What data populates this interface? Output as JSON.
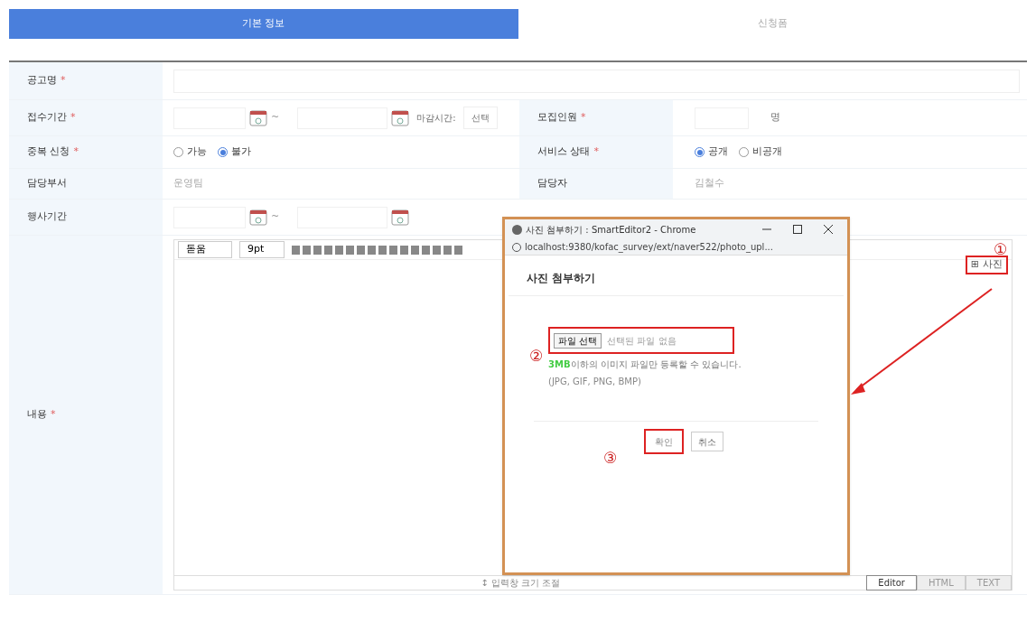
{
  "tabs": [
    {
      "label": "기본 정보",
      "selected": true
    },
    {
      "label": "신청폼",
      "selected": false
    }
  ],
  "title_row": {
    "label": "공고명",
    "required_mark": "*"
  },
  "period_row": {
    "label": "접수기간",
    "required_mark": "*",
    "separator": "~",
    "deadline_label": "마감시간:",
    "deadline_select": "선택"
  },
  "capacity": {
    "label": "모집인원",
    "required_mark": "*",
    "unit": "명"
  },
  "duplicate": {
    "label": "중복 신청",
    "required_mark": "*",
    "options": [
      {
        "label": "가능",
        "selected": false
      },
      {
        "label": "불가",
        "selected": true
      }
    ]
  },
  "service": {
    "label": "서비스 상태",
    "required_mark": "*",
    "options": [
      {
        "label": "공개",
        "selected": true
      },
      {
        "label": "비공개",
        "selected": false
      }
    ]
  },
  "department": {
    "label": "담당부서",
    "value": "운영팀"
  },
  "manager": {
    "label": "담당자",
    "value": "김철수"
  },
  "event_period": {
    "label": "행사기간",
    "separator": "~"
  },
  "content": {
    "label": "내용",
    "required_mark": "*",
    "toolbar": {
      "font": "돋움",
      "size": "9pt"
    },
    "photo_icon": "⊞",
    "photo_button": "사진",
    "resize": "↕ 입력창 크기 조절",
    "modes": [
      {
        "label": "Editor",
        "selected": true
      },
      {
        "label": "HTML",
        "selected": false
      },
      {
        "label": "TEXT",
        "selected": false
      }
    ]
  },
  "popup": {
    "title": "사진 첨부하기 : SmartEditor2 - Chrome",
    "url": "localhost:9380/kofac_survey/ext/naver522/photo_upl...",
    "heading": "사진 첨부하기",
    "file_button": "파일 선택",
    "file_status": "선택된 파일 없음",
    "note": "**3MB**이하의 이미지 파일만 등록할 수 있습니다.",
    "formats": "(JPG, GIF, PNG, BMP)",
    "ok": "확인",
    "cancel": "취소"
  },
  "annotations": [
    "①",
    "②",
    "③"
  ]
}
